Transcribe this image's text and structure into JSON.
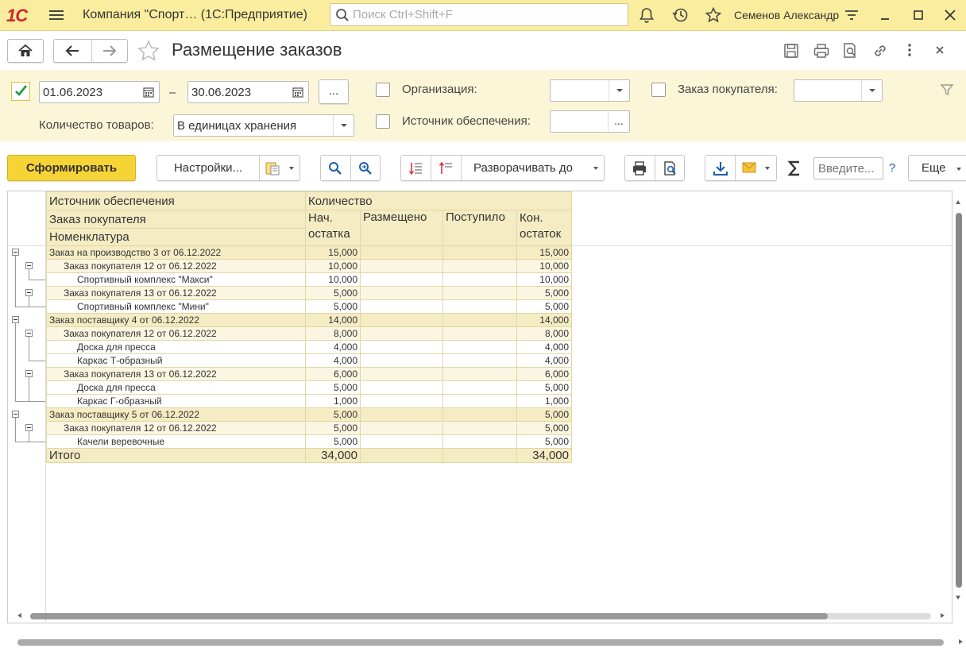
{
  "app": {
    "logo": "1С",
    "title": "Компания \"Спорт… (1С:Предприятие)",
    "search_placeholder": "Поиск Ctrl+Shift+F",
    "user": "Семенов Александр"
  },
  "form": {
    "title": "Размещение заказов"
  },
  "filters": {
    "date_from": "01.06.2023",
    "date_sep": "–",
    "date_to": "30.06.2023",
    "more_btn": "...",
    "period_checked": true,
    "org_label": "Организация:",
    "org_value": "",
    "order_label": "Заказ покупателя:",
    "order_value": "",
    "qty_label": "Количество товаров:",
    "qty_value": "В единицах хранения",
    "source_label": "Источник обеспечения:",
    "source_value": "",
    "source_btn": "..."
  },
  "toolbar": {
    "generate": "Сформировать",
    "settings": "Настройки...",
    "expand_to": "Разворачивать до",
    "input_placeholder": "Введите...",
    "help": "?",
    "more": "Еще"
  },
  "report": {
    "headers": {
      "group1": "Источник обеспечения",
      "group2": "Заказ покупателя",
      "group3": "Номенклатура",
      "quantity": "Количество",
      "col_start_l1": "Нач.",
      "col_start_l2": "остатка",
      "col_placed": "Размещено",
      "col_received": "Поступило",
      "col_end_l1": "Кон.",
      "col_end_l2": "остаток"
    },
    "rows": [
      {
        "level": 1,
        "name": "Заказ на производство 3 от 06.12.2022",
        "start": "15,000",
        "placed": "",
        "received": "",
        "end": "15,000"
      },
      {
        "level": 2,
        "name": "Заказ покупателя 12 от 06.12.2022",
        "start": "10,000",
        "placed": "",
        "received": "",
        "end": "10,000"
      },
      {
        "level": 3,
        "name": "Спортивный комплекс \"Макси\"",
        "start": "10,000",
        "placed": "",
        "received": "",
        "end": "10,000"
      },
      {
        "level": 2,
        "name": "Заказ покупателя 13 от 06.12.2022",
        "start": "5,000",
        "placed": "",
        "received": "",
        "end": "5,000"
      },
      {
        "level": 3,
        "name": "Спортивный комплекс \"Мини\"",
        "start": "5,000",
        "placed": "",
        "received": "",
        "end": "5,000"
      },
      {
        "level": 1,
        "name": "Заказ поставщику 4 от 06.12.2022",
        "start": "14,000",
        "placed": "",
        "received": "",
        "end": "14,000"
      },
      {
        "level": 2,
        "name": "Заказ покупателя 12 от 06.12.2022",
        "start": "8,000",
        "placed": "",
        "received": "",
        "end": "8,000"
      },
      {
        "level": 3,
        "name": "Доска для пресса",
        "start": "4,000",
        "placed": "",
        "received": "",
        "end": "4,000"
      },
      {
        "level": 3,
        "name": "Каркас Т-образный",
        "start": "4,000",
        "placed": "",
        "received": "",
        "end": "4,000"
      },
      {
        "level": 2,
        "name": "Заказ покупателя 13 от 06.12.2022",
        "start": "6,000",
        "placed": "",
        "received": "",
        "end": "6,000"
      },
      {
        "level": 3,
        "name": "Доска для пресса",
        "start": "5,000",
        "placed": "",
        "received": "",
        "end": "5,000"
      },
      {
        "level": 3,
        "name": "Каркас Г-образный",
        "start": "1,000",
        "placed": "",
        "received": "",
        "end": "1,000"
      },
      {
        "level": 1,
        "name": "Заказ поставщику 5 от 06.12.2022",
        "start": "5,000",
        "placed": "",
        "received": "",
        "end": "5,000"
      },
      {
        "level": 2,
        "name": "Заказ покупателя 12 от 06.12.2022",
        "start": "5,000",
        "placed": "",
        "received": "",
        "end": "5,000"
      },
      {
        "level": 3,
        "name": "Качели веревочные",
        "start": "5,000",
        "placed": "",
        "received": "",
        "end": "5,000"
      }
    ],
    "total": {
      "name": "Итого",
      "start": "34,000",
      "placed": "",
      "received": "",
      "end": "34,000"
    }
  }
}
